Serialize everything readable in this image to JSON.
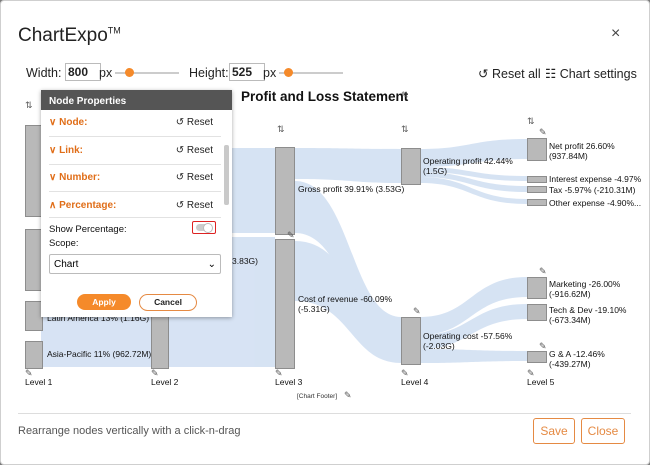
{
  "app": {
    "title": "ChartExpo",
    "tm": "TM",
    "close": "×"
  },
  "toolbar": {
    "width_label": "Width:",
    "width_value": "800",
    "px1": "px",
    "height_label": "Height:",
    "height_value": "525",
    "px2": "px",
    "reset_all": "Reset all",
    "chart_settings": "Chart settings"
  },
  "chart": {
    "title": "Profit and Loss Statement",
    "footer": "[Chart Footer]",
    "levels": [
      "Level 1",
      "Level 2",
      "Level 3",
      "Level 4",
      "Level 5"
    ],
    "labels": {
      "l1_latin": "Latin America 13% (1.16G)",
      "l1_asia": "Asia-Pacific 11% (962.72M)",
      "l2_partial": "3.83G)",
      "gross_profit": "Gross profit 39.91% (3.53G)",
      "cost_rev_1": "Cost of revenue -60.09%",
      "cost_rev_2": "(-5.31G)",
      "op_profit_1": "Operating profit 42.44%",
      "op_profit_2": "(1.5G)",
      "op_cost_1": "Operating cost -57.56%",
      "op_cost_2": "(-2.03G)",
      "net_profit_1": "Net profit 26.60%",
      "net_profit_2": "(937.84M)",
      "interest": "Interest expense -4.97%",
      "tax": "Tax -5.97% (-210.31M)",
      "other": "Other expense -4.90%...",
      "marketing_1": "Marketing -26.00%",
      "marketing_2": "(-916.62M)",
      "tech_1": "Tech & Dev -19.10%",
      "tech_2": "(-673.34M)",
      "ga_1": "G & A -12.46%",
      "ga_2": "(-439.27M)"
    }
  },
  "panel": {
    "title": "Node Properties",
    "rows": [
      {
        "label": "Node:",
        "reset": "Reset"
      },
      {
        "label": "Link:",
        "reset": "Reset"
      },
      {
        "label": "Number:",
        "reset": "Reset"
      },
      {
        "label": "Percentage:",
        "reset": "Reset"
      }
    ],
    "show_percentage": "Show Percentage:",
    "scope_label": "Scope:",
    "scope_value": "Chart",
    "apply": "Apply",
    "cancel": "Cancel"
  },
  "footer": {
    "hint": "Rearrange nodes vertically with a click-n-drag",
    "save": "Save",
    "close": "Close"
  }
}
